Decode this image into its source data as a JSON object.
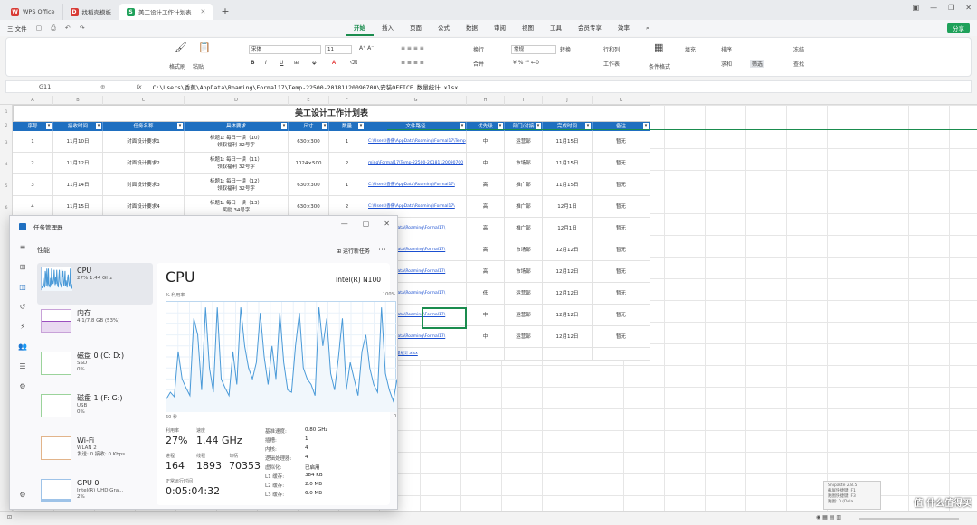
{
  "tabs": [
    {
      "label": "WPS Office",
      "color": "#d83b35",
      "logo": "W"
    },
    {
      "label": "找稻壳模板",
      "color": "#d83b35",
      "logo": "D"
    },
    {
      "label": "美工设计工作计划表",
      "color": "#1fa15a",
      "logo": "S"
    }
  ],
  "menubar": {
    "file": "三 文件",
    "menus": [
      "开始",
      "插入",
      "页面",
      "公式",
      "数据",
      "审阅",
      "视图",
      "工具",
      "会员专享",
      "效率"
    ],
    "active": "开始",
    "share": "分享"
  },
  "ribbon": {
    "format_painter": "格式刷",
    "paste": "粘贴",
    "font_name": "宋体",
    "font_size": "11",
    "wrap": "换行",
    "merge": "合并",
    "number_format": "常规",
    "convert": "转换",
    "row_col": "行和列",
    "worksheet": "工作表",
    "conditional": "条件格式",
    "fill": "填充",
    "sort": "排序",
    "freeze": "冻结",
    "sum": "求和",
    "filter": "筛选",
    "find": "查找"
  },
  "formula_bar": {
    "cell_ref": "G11",
    "fx": "fx",
    "formula": "C:\\Users\\香蕉\\AppData\\Roaming\\Formal17\\Temp-22500-20181120090700\\安装OFFICE 数量统计.xlsx"
  },
  "sheet": {
    "title": "美工设计工作计划表",
    "headers": [
      "序号",
      "接收时间",
      "任务名称",
      "具体要求",
      "尺寸",
      "数量",
      "文件路径",
      "优先级",
      "部门/对接",
      "完成时间",
      "备注"
    ],
    "rows": [
      [
        "1",
        "11月10日",
        "封面设计要求1",
        "标题1: 每日一读（10）|领取福利 32号字",
        "630×300",
        "1",
        "C:\\Users\\香蕉\\AppData\\Roaming\\Formal17\\Temp",
        "中",
        "运营部",
        "11月15日",
        "暂无"
      ],
      [
        "2",
        "11月12日",
        "封面设计要求2",
        "标题1: 每日一读（11）|领取福利 32号字",
        "1024×500",
        "2",
        "ming\\Formal17\\Temp-22500-20181120090700",
        "中",
        "市场部",
        "11月15日",
        "暂无"
      ],
      [
        "3",
        "11月14日",
        "封面设计要求3",
        "标题1: 每日一读（12）|领取福利 32号字",
        "630×300",
        "1",
        "C:\\Users\\香蕉\\AppData\\Roaming\\Formal17\\",
        "高",
        "推广部",
        "11月15日",
        "暂无"
      ],
      [
        "4",
        "11月15日",
        "封面设计要求4",
        "标题1: 每日一读（13）|奖励 34号字",
        "630×300",
        "2",
        "C:\\Users\\香蕉\\AppData\\Roaming\\Formal17\\",
        "高",
        "推广部",
        "12月1日",
        "暂无"
      ],
      [
        "5",
        "",
        "",
        "",
        "",
        "",
        "C:\\Users\\AppData\\Roaming\\Formal17\\",
        "高",
        "推广部",
        "12月1日",
        "暂无"
      ],
      [
        "6",
        "",
        "",
        "",
        "",
        "",
        "C:\\Users\\AppData\\Roaming\\Formal17\\",
        "高",
        "市场部",
        "12月12日",
        "暂无"
      ],
      [
        "7",
        "",
        "",
        "",
        "",
        "",
        "C:\\Users\\AppData\\Roaming\\Formal17\\",
        "高",
        "市场部",
        "12月12日",
        "暂无"
      ],
      [
        "8",
        "",
        "",
        "",
        "",
        "",
        "C:\\Users\\AppData\\Roaming\\Formal17\\",
        "低",
        "运营部",
        "12月12日",
        "暂无"
      ],
      [
        "9",
        "",
        "",
        "",
        "",
        "",
        "C:\\Users\\AppData\\Roaming\\Formal17\\",
        "中",
        "运营部",
        "12月12日",
        "暂无"
      ],
      [
        "10",
        "",
        "",
        "",
        "",
        "",
        "C:\\Users\\AppData\\Roaming\\Formal17\\",
        "中",
        "运营部",
        "12月12日",
        "暂无"
      ]
    ],
    "last_link": "安装OFFICE 数量统计.xlsx"
  },
  "task_manager": {
    "title": "任务管理器",
    "section": "性能",
    "run_task": "运行新任务",
    "devices": [
      {
        "name": "CPU",
        "line1": "27% 1.44 GHz",
        "line2": ""
      },
      {
        "name": "内存",
        "line1": "4.1/7.8 GB (53%)",
        "line2": ""
      },
      {
        "name": "磁盘 0 (C: D:)",
        "line1": "SSD",
        "line2": "0%"
      },
      {
        "name": "磁盘 1 (F: G:)",
        "line1": "USB",
        "line2": "0%"
      },
      {
        "name": "Wi-Fi",
        "line1": "WLAN 2",
        "line2": "发送: 0 接收: 0 Kbps"
      },
      {
        "name": "GPU 0",
        "line1": "Intel(R) UHD Gra...",
        "line2": "2%"
      }
    ],
    "cpu": {
      "heading": "CPU",
      "model": "Intel(R) N100",
      "util_label": "% 利用率",
      "util_max": "100%",
      "time_label": "60 秒",
      "time_end": "0",
      "usage_label": "利用率",
      "usage": "27%",
      "speed_label": "速度",
      "speed": "1.44 GHz",
      "proc_label": "进程",
      "proc": "164",
      "threads_label": "线程",
      "threads": "1893",
      "handles_label": "句柄",
      "handles": "70353",
      "uptime_label": "正常运行时间",
      "uptime": "0:05:04:32",
      "specs": [
        [
          "基准速度:",
          "0.80 GHz"
        ],
        [
          "插槽:",
          "1"
        ],
        [
          "内核:",
          "4"
        ],
        [
          "逻辑处理器:",
          "4"
        ],
        [
          "虚拟化:",
          "已启用"
        ],
        [
          "L1 缓存:",
          "384 KB"
        ],
        [
          "L2 缓存:",
          "2.0 MB"
        ],
        [
          "L3 缓存:",
          "6.0 MB"
        ]
      ],
      "history": [
        12,
        18,
        14,
        55,
        30,
        22,
        15,
        85,
        70,
        20,
        95,
        40,
        18,
        95,
        30,
        22,
        15,
        55,
        25,
        95,
        60,
        40,
        30,
        45,
        90,
        50,
        25,
        60,
        30,
        90,
        45,
        20,
        18,
        60,
        90,
        40,
        30,
        25,
        15,
        95,
        60,
        85,
        35,
        20,
        50,
        85,
        20,
        45,
        30,
        15,
        55,
        70,
        40,
        25,
        18,
        95,
        35,
        20,
        10,
        30
      ]
    }
  },
  "snipaste": [
    "Snipaste 2.8.5",
    "截屏快捷键: F1",
    "贴图快捷键: F3",
    "贴图: 0 (Dela..."
  ],
  "watermark": "值 什么值得买",
  "colors": {
    "accent": "#1fa15a",
    "header_blue": "#1f6fc0",
    "link": "#1a4fd1",
    "cpu_line": "#4a9ad8"
  }
}
